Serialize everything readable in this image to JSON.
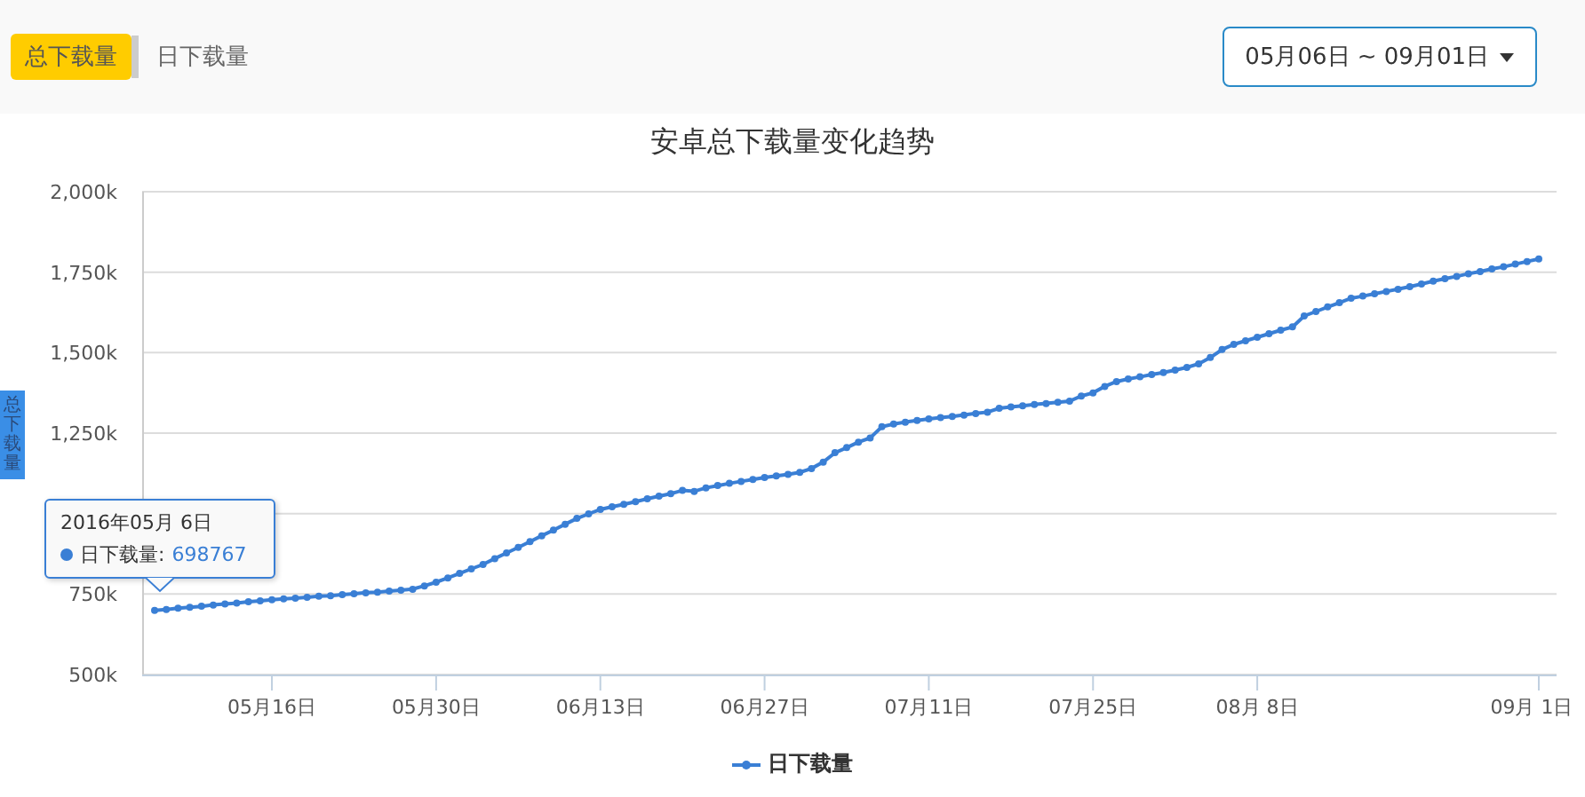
{
  "tabs": [
    {
      "label": "总下载量",
      "selected": true
    },
    {
      "label": "日下载量",
      "selected": false
    }
  ],
  "date_range": {
    "label": "05月06日 ~ 09月01日"
  },
  "side_tab": {
    "label": "总下载量"
  },
  "chart": {
    "chart_data": {
      "type": "line",
      "title": "安卓总下载量变化趋势",
      "ylim": [
        500,
        2000
      ],
      "grid": true,
      "yticks": [
        {
          "value": 500,
          "label": "500k"
        },
        {
          "value": 750,
          "label": "750k"
        },
        {
          "value": 1250,
          "label": "1,250k"
        },
        {
          "value": 1500,
          "label": "1,500k"
        },
        {
          "value": 1750,
          "label": "1,750k"
        },
        {
          "value": 2000,
          "label": "2,000k"
        }
      ],
      "categories": [
        null,
        null,
        null,
        null,
        null,
        null,
        null,
        null,
        null,
        null,
        "05月16日",
        null,
        null,
        null,
        null,
        null,
        null,
        null,
        null,
        null,
        null,
        null,
        null,
        null,
        "05月30日",
        null,
        null,
        null,
        null,
        null,
        null,
        null,
        null,
        null,
        null,
        null,
        null,
        null,
        "06月13日",
        null,
        null,
        null,
        null,
        null,
        null,
        null,
        null,
        null,
        null,
        null,
        null,
        null,
        "06月27日",
        null,
        null,
        null,
        null,
        null,
        null,
        null,
        null,
        null,
        null,
        null,
        null,
        null,
        "07月11日",
        null,
        null,
        null,
        null,
        null,
        null,
        null,
        null,
        null,
        null,
        null,
        null,
        null,
        "07月25日",
        null,
        null,
        null,
        null,
        null,
        null,
        null,
        null,
        null,
        null,
        null,
        null,
        null,
        "08月 8日",
        null,
        null,
        null,
        null,
        null,
        null,
        null,
        null,
        null,
        null,
        null,
        null,
        null,
        null,
        null,
        null,
        null,
        null,
        null,
        null,
        null,
        null,
        null,
        "09月 1日"
      ],
      "series": [
        {
          "name": "日下载量",
          "color": "#3a7fd5",
          "marker": true,
          "values": [
            699,
            702,
            706,
            709,
            712,
            716,
            719,
            722,
            726,
            729,
            732,
            735,
            737,
            740,
            743,
            745,
            748,
            751,
            754,
            756,
            759,
            762,
            765,
            775,
            787,
            800,
            814,
            828,
            842,
            860,
            878,
            895,
            913,
            931,
            949,
            967,
            985,
            999,
            1013,
            1021,
            1029,
            1037,
            1046,
            1054,
            1062,
            1072,
            1069,
            1080,
            1087,
            1094,
            1100,
            1106,
            1112,
            1117,
            1122,
            1128,
            1140,
            1160,
            1189,
            1205,
            1222,
            1235,
            1270,
            1278,
            1284,
            1289,
            1294,
            1298,
            1302,
            1306,
            1311,
            1315,
            1327,
            1331,
            1335,
            1339,
            1342,
            1346,
            1349,
            1365,
            1375,
            1395,
            1410,
            1418,
            1425,
            1432,
            1438,
            1446,
            1454,
            1465,
            1485,
            1510,
            1526,
            1537,
            1548,
            1559,
            1570,
            1580,
            1614,
            1628,
            1642,
            1655,
            1669,
            1676,
            1683,
            1690,
            1697,
            1705,
            1713,
            1722,
            1730,
            1737,
            1745,
            1752,
            1760,
            1767,
            1775,
            1783,
            1791
          ]
        }
      ]
    },
    "tooltip": {
      "title": "2016年05月 6日",
      "series_label": "日下载量:",
      "value": "698767"
    }
  }
}
